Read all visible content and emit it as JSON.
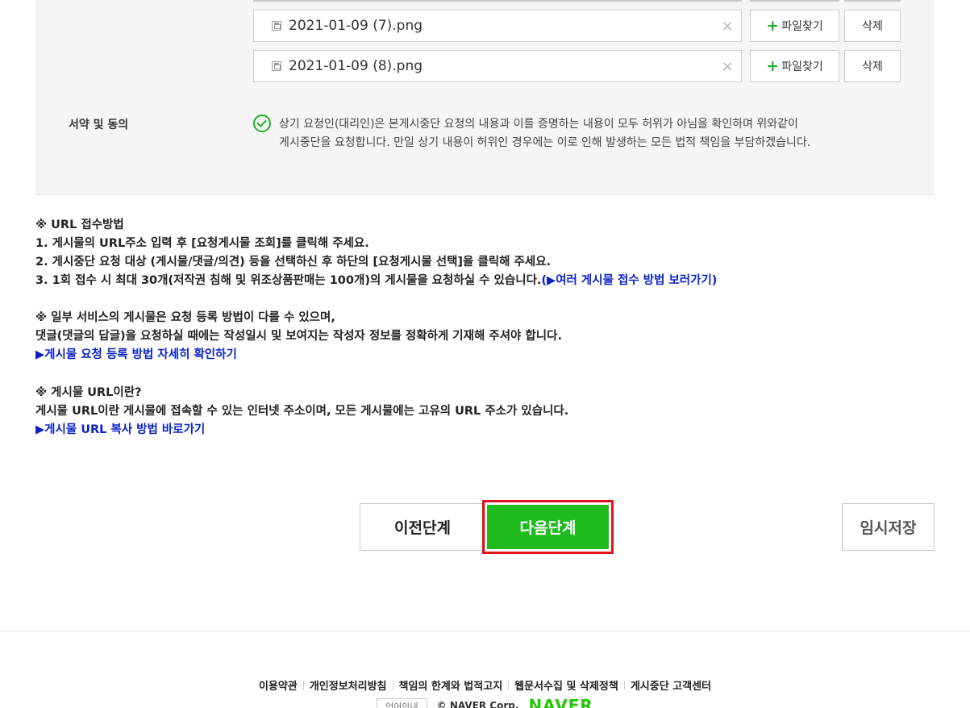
{
  "files": [
    {
      "name": "2021-01-09 (7).png",
      "clear": "×",
      "find_label": "파일찾기",
      "find_icon": "+",
      "delete_label": "삭제"
    },
    {
      "name": "2021-01-09 (8).png",
      "clear": "×",
      "find_label": "파일찾기",
      "find_icon": "+",
      "delete_label": "삭제"
    }
  ],
  "agreement": {
    "label": "서약 및 동의",
    "checked": true,
    "line1": "상기 요청인(대리인)은 본게시중단 요청의 내용과 이를 증명하는 내용이 모두 허위가 아님을 확인하며 위와같이",
    "line2": "게시중단을 요청합니다. 만일 상기 내용이 허위인 경우에는 이로 인해 발생하는 모든 법적 책임을 부담하겠습니다."
  },
  "notice1": {
    "title": "※ URL 접수방법",
    "step1": "1. 게시물의 URL주소 입력 후 [요청게시물 조회]를 클릭해 주세요.",
    "step2": "2. 게시중단 요청 대상 (게시물/댓글/의견) 등을 선택하신 후 하단의 [요청게시물 선택]을 클릭해 주세요.",
    "step3": "3. 1회 접수 시 최대 30개(저작권 침해 및 위조상품판매는 100개)의 게시물을 요청하실 수 있습니다.",
    "step3_link": "(▶여러 게시물 접수 방법 보러가기)"
  },
  "notice2": {
    "line1": "※ 일부 서비스의 게시물은 요청 등록 방법이 다를 수 있으며,",
    "line2": "댓글(댓글의 답글)을 요청하실 때에는 작성일시 및 보여지는 작성자 정보를 정확하게 기재해 주셔야 합니다.",
    "link": "▶게시물 요청 등록 방법 자세히 확인하기"
  },
  "notice3": {
    "title": "※ 게시물 URL이란?",
    "line1": "게시물 URL이란 게시물에 접속할 수 있는 인터넷 주소이며, 모든 게시물에는 고유의 URL 주소가 있습니다.",
    "link": "▶게시물 URL 복사 방법 바로가기"
  },
  "buttons": {
    "prev": "이전단계",
    "next": "다음단계",
    "temp_save": "임시저장"
  },
  "footer": {
    "links": [
      "이용약관",
      "개인정보처리방침",
      "책임의 한계와 법적고지",
      "웹문서수집 및 삭제정책",
      "게시중단 고객센터"
    ],
    "lang": "언어안내",
    "copyright": "© NAVER Corp.",
    "logo": "NAVER"
  },
  "colors": {
    "accent_green": "#1fbc1f",
    "highlight_red": "#e0151b",
    "link_blue": "#0a22c9"
  }
}
